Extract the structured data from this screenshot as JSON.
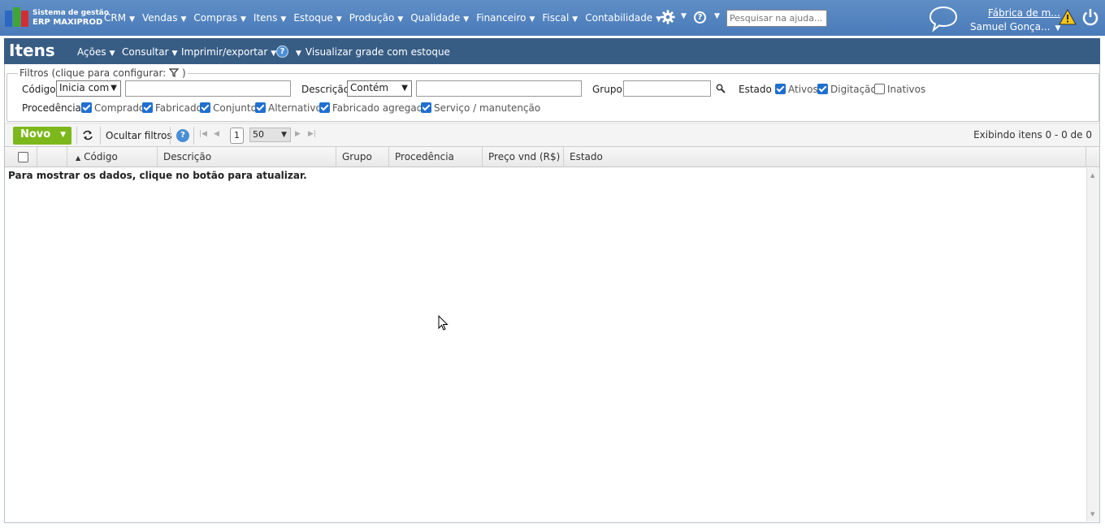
{
  "topbar": {
    "brand_line1": "Sistema de gestão",
    "brand_line2": "ERP MAXIPROD",
    "menu": [
      "CRM",
      "Vendas",
      "Compras",
      "Itens",
      "Estoque",
      "Produção",
      "Qualidade",
      "Financeiro",
      "Fiscal",
      "Contabilidade"
    ],
    "search_placeholder": "Pesquisar na ajuda...",
    "company": "Fábrica de m...",
    "user": "Samuel Gonça..."
  },
  "page": {
    "title": "Itens",
    "menu": [
      "Ações",
      "Consultar",
      "Imprimir/exportar"
    ],
    "view_stock_grid": "Visualizar grade com estoque"
  },
  "filters": {
    "legend": "Filtros (clique para configurar:",
    "legend_close": ")",
    "code_label": "Código",
    "code_mode": "Inicia com",
    "description_label": "Descrição",
    "description_mode": "Contém",
    "group_label": "Grupo",
    "state_label": "Estado",
    "states": [
      {
        "label": "Ativos",
        "checked": true
      },
      {
        "label": "Digitação",
        "checked": true
      },
      {
        "label": "Inativos",
        "checked": false
      }
    ],
    "origin_label": "Procedência",
    "origins": [
      {
        "label": "Comprado",
        "checked": true
      },
      {
        "label": "Fabricado",
        "checked": true
      },
      {
        "label": "Conjunto",
        "checked": true
      },
      {
        "label": "Alternativo",
        "checked": true
      },
      {
        "label": "Fabricado agregado",
        "checked": true
      },
      {
        "label": "Serviço / manutenção",
        "checked": true
      }
    ]
  },
  "toolbar": {
    "new_label": "Novo",
    "hide_filters": "Ocultar filtros",
    "page_number": "1",
    "page_size": "50",
    "showing": "Exibindo itens 0 - 0 de 0"
  },
  "grid": {
    "columns": [
      "Código",
      "Descrição",
      "Grupo",
      "Procedência",
      "Preço vnd (R$)",
      "Estado"
    ],
    "empty_message": "Para mostrar os dados, clique no botão para atualizar."
  },
  "colors": {
    "topbar": "#4a7bb9",
    "titlebar": "#385d85",
    "new_button": "#7cb81c",
    "checkbox": "#1f6fd0"
  }
}
